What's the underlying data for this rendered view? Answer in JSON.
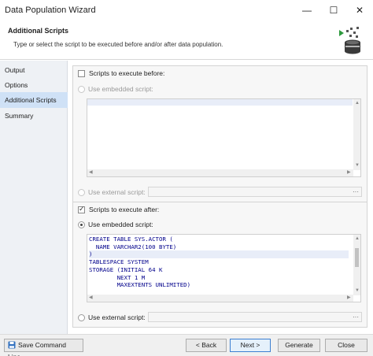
{
  "window": {
    "title": "Data Population Wizard",
    "minimize_glyph": "—",
    "maximize_glyph": "☐",
    "close_glyph": "✕"
  },
  "header": {
    "title": "Additional Scripts",
    "subtitle": "Type or select the script to be executed before and/or after data population.",
    "icon": "data-population-icon"
  },
  "nav": {
    "items": [
      {
        "label": "Output",
        "active": false
      },
      {
        "label": "Options",
        "active": false
      },
      {
        "label": "Additional Scripts",
        "active": true
      },
      {
        "label": "Summary",
        "active": false
      }
    ]
  },
  "before": {
    "checkbox_label": "Scripts to execute before:",
    "checked": false,
    "embedded_label": "Use embedded script:",
    "external_label": "Use external script:",
    "browse": "···"
  },
  "after": {
    "checkbox_label": "Scripts to execute after:",
    "checked": true,
    "embedded_label": "Use embedded script:",
    "external_label": "Use external script:",
    "browse": "···",
    "code_lines": [
      "CREATE TABLE SYS.ACTOR (",
      "  NAME VARCHAR2(100 BYTE)",
      ")",
      "TABLESPACE SYSTEM",
      "STORAGE (INITIAL 64 K",
      "        NEXT 1 M",
      "        MAXEXTENTS UNLIMITED)"
    ]
  },
  "footer": {
    "save_command_line": "Save Command Line...",
    "back": "< Back",
    "next": "Next >",
    "generate": "Generate",
    "close": "Close"
  }
}
